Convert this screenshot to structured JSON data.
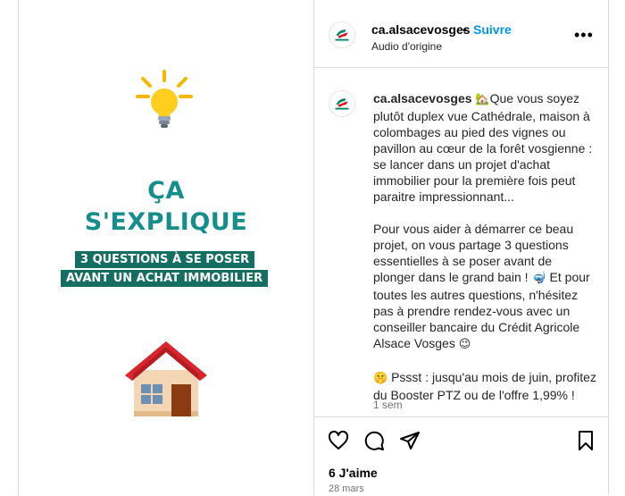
{
  "media": {
    "headline_line1": "ÇA",
    "headline_line2": "S'EXPLIQUE",
    "banner_line1": "3 QUESTIONS À SE POSER",
    "banner_line2": "AVANT UN ACHAT IMMOBILIER"
  },
  "header": {
    "username": "ca.alsacevosges",
    "separator": "•",
    "follow_label": "Suivre",
    "audio_label": "Audio d'origine",
    "more_label": "•••"
  },
  "caption": {
    "username": "ca.alsacevosges",
    "emoji_house": "🏡",
    "paragraph1": "Que vous soyez plutôt duplex vue Cathédrale, maison à colombages au pied des vignes ou pavillon au cœur de la forêt vosgienne : se lancer dans un projet d'achat immobilier pour la première fois peut paraitre impressionnant...",
    "paragraph2a": "Pour vous aider à démarrer ce beau projet, on vous partage 3 questions essentielles à se poser avant de plonger dans le grand bain !",
    "emoji_mask": "🤿",
    "paragraph2b": "Et pour toutes les autres questions, n'hésitez pas à prendre rendez-vous avec un conseiller bancaire du Crédit Agricole Alsace Vosges",
    "emoji_wink": "😉",
    "emoji_hush": "🤫",
    "paragraph3": "Pssst : jusqu'au mois de juin, profitez du Booster PTZ ou de l'offre 1,99% !",
    "time_ago": "1 sem"
  },
  "footer": {
    "likes": "6 J'aime",
    "date": "28 mars"
  },
  "icons": {
    "like": "heart-icon",
    "comment": "comment-icon",
    "share": "share-icon",
    "save": "bookmark-icon"
  },
  "colors": {
    "teal_text": "#168f8c",
    "banner_bg": "#146e62",
    "follow": "#0095f6",
    "brand_green": "#00855f",
    "brand_red": "#e2001a"
  }
}
